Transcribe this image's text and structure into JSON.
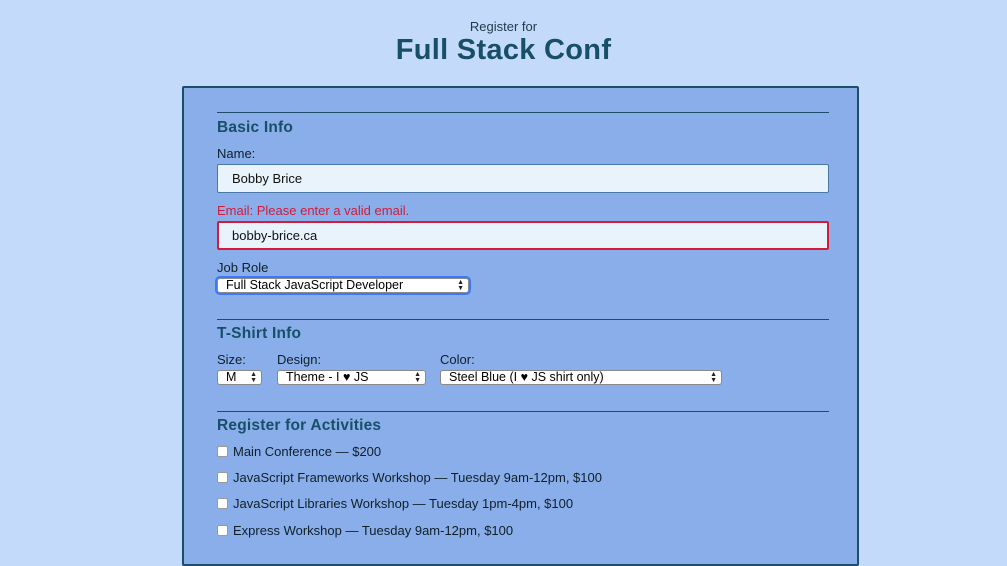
{
  "header": {
    "pre_title": "Register for",
    "title": "Full Stack Conf"
  },
  "basic_info": {
    "title": "Basic Info",
    "name_label": "Name:",
    "name_value": "Bobby Brice",
    "email_label": "Email: Please enter a valid email.",
    "email_value": "bobby-brice.ca",
    "job_role_label": "Job Role",
    "job_role_selected": "Full Stack JavaScript Developer"
  },
  "tshirt_info": {
    "title": "T-Shirt Info",
    "size_label": "Size:",
    "size_selected": "M",
    "design_label": "Design:",
    "design_selected": "Theme - I ♥ JS",
    "color_label": "Color:",
    "color_selected": "Steel Blue (I ♥ JS shirt only)"
  },
  "activities": {
    "title": "Register for Activities",
    "items": [
      {
        "label": "Main Conference — $200",
        "checked": false
      },
      {
        "label": "JavaScript Frameworks Workshop — Tuesday 9am-12pm, $100",
        "checked": false
      },
      {
        "label": "JavaScript Libraries Workshop — Tuesday 1pm-4pm, $100",
        "checked": false
      },
      {
        "label": "Express Workshop — Tuesday 9am-12pm, $100",
        "checked": false
      }
    ]
  },
  "colors": {
    "page_background": "#c4dafa",
    "form_background": "#8aaeea",
    "heading": "#184f68",
    "error": "#d41a3a",
    "focus_ring": "#3b79f5"
  }
}
